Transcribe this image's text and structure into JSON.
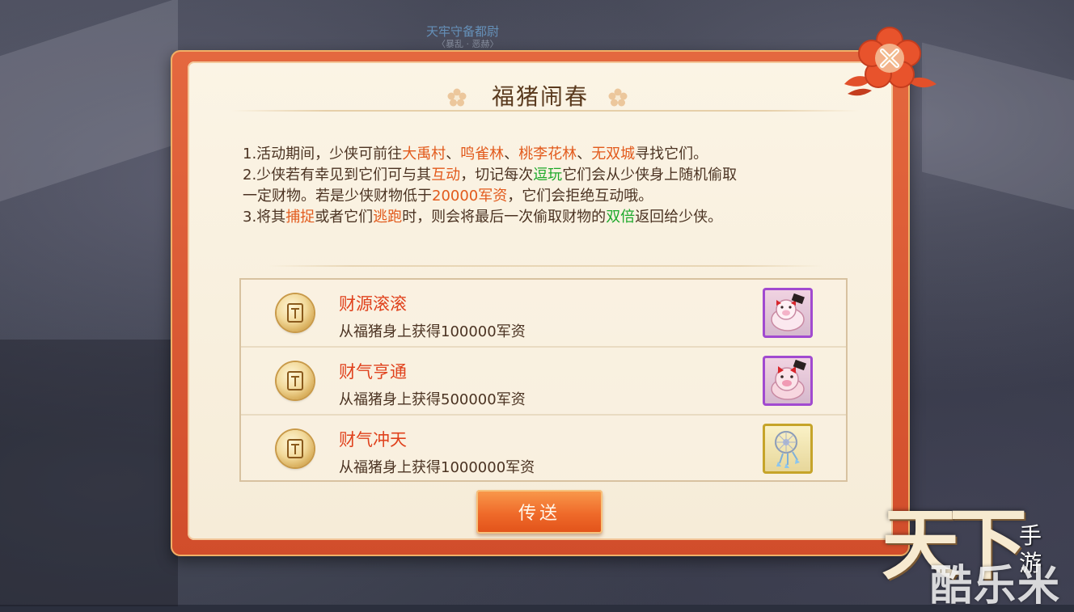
{
  "background": {
    "npc_name": "天牢守备都尉",
    "npc_sub": "〈暴乱 · 恶赫〉"
  },
  "dialog": {
    "title": "福猪闹春",
    "description": [
      [
        {
          "t": "1.活动期间，少侠可前往",
          "c": ""
        },
        {
          "t": "大禹村",
          "c": "o"
        },
        {
          "t": "、",
          "c": ""
        },
        {
          "t": "鸣雀林",
          "c": "o"
        },
        {
          "t": "、",
          "c": ""
        },
        {
          "t": "桃李花林",
          "c": "o"
        },
        {
          "t": "、",
          "c": ""
        },
        {
          "t": "无双城",
          "c": "o"
        },
        {
          "t": "寻找它们。",
          "c": ""
        }
      ],
      [
        {
          "t": "2.少侠若有幸见到它们可与其",
          "c": ""
        },
        {
          "t": "互动",
          "c": "o"
        },
        {
          "t": "，切记每次",
          "c": ""
        },
        {
          "t": "逗玩",
          "c": "g"
        },
        {
          "t": "它们会从少侠身上随机偷取",
          "c": ""
        }
      ],
      [
        {
          "t": "一定财物。若是少侠财物低于",
          "c": ""
        },
        {
          "t": "20000军资",
          "c": "o"
        },
        {
          "t": "，它们会拒绝互动哦。",
          "c": ""
        }
      ],
      [
        {
          "t": "3.将其",
          "c": ""
        },
        {
          "t": "捕捉",
          "c": "o"
        },
        {
          "t": "或者它们",
          "c": ""
        },
        {
          "t": "逃跑",
          "c": "o"
        },
        {
          "t": "时，则会将最后一次偷取财物的",
          "c": ""
        },
        {
          "t": "双倍",
          "c": "g"
        },
        {
          "t": "返回给少侠。",
          "c": ""
        }
      ]
    ],
    "rewards": [
      {
        "name": "财源滚滚",
        "desc": "从福猪身上获得100000军资",
        "item_icon": "pig-icon",
        "rarity": "purple"
      },
      {
        "name": "财气亨通",
        "desc": "从福猪身上获得500000军资",
        "item_icon": "pig-icon",
        "rarity": "purple"
      },
      {
        "name": "财气冲天",
        "desc": "从福猪身上获得1000000军资",
        "item_icon": "dreamcatcher-icon",
        "rarity": "gold"
      }
    ],
    "send_label": "传送",
    "close_icon": "close-icon"
  },
  "branding": {
    "logo_main": "天下",
    "logo_sub": "手游",
    "watermark": "酷乐米"
  },
  "colors": {
    "frame": "#d9552f",
    "panel": "#f8efdd",
    "highlight_orange": "#e25a1c",
    "highlight_green": "#1ea92b",
    "reward_name": "#e0421d",
    "item_purple": "#a14ad0",
    "item_gold": "#c6a42a"
  }
}
